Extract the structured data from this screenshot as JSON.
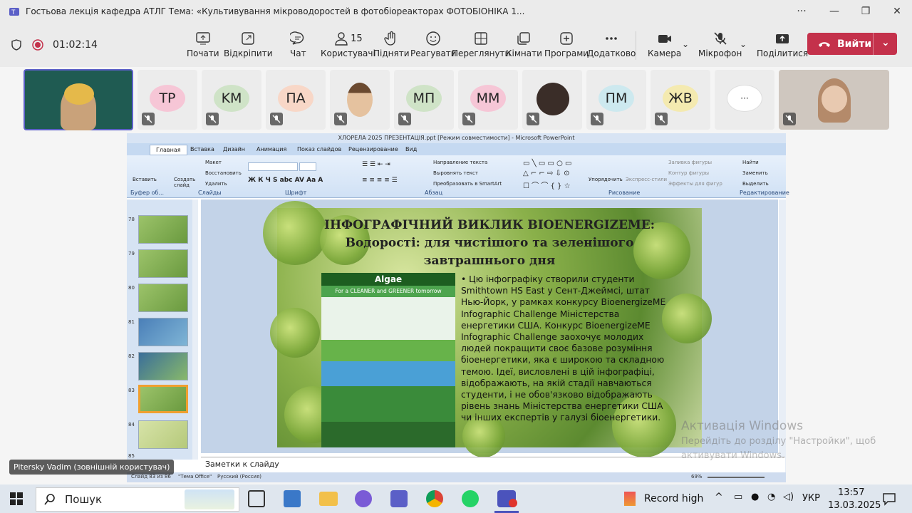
{
  "window": {
    "title": "Гостьова лекція кафедра АТЛГ Тема: «Культивування мікроводоростей в фотобіореакторах ФОТОБІОНІКА 1...",
    "more": "···"
  },
  "meeting": {
    "timer": "01:02:14",
    "toolbar": [
      {
        "label": "Почати",
        "icon": "start-icon"
      },
      {
        "label": "Відкріпити",
        "icon": "unpin-icon"
      },
      {
        "label": "Чат",
        "icon": "chat-icon"
      },
      {
        "label": "Користувачі",
        "icon": "people-icon",
        "count": "15"
      },
      {
        "label": "Підняти",
        "icon": "raise-hand-icon"
      },
      {
        "label": "Реагувати",
        "icon": "react-icon"
      },
      {
        "label": "Переглянути",
        "icon": "view-icon"
      },
      {
        "label": "Кімнати",
        "icon": "rooms-icon"
      },
      {
        "label": "Програми",
        "icon": "apps-icon"
      },
      {
        "label": "Додатково",
        "icon": "more-icon"
      },
      {
        "label": "Камера",
        "icon": "camera-icon"
      },
      {
        "label": "Мікрофон",
        "icon": "mic-off-icon"
      },
      {
        "label": "Поділитися",
        "icon": "share-icon"
      }
    ],
    "leave_label": "Вийти",
    "participants": [
      {
        "initials": "TP",
        "color": "#f6c6d6"
      },
      {
        "initials": "KM",
        "color": "#cfe3c7"
      },
      {
        "initials": "ПА",
        "color": "#f8d7c7"
      },
      {
        "initials": "МП",
        "color": "#cfe3c7"
      },
      {
        "initials": "ММ",
        "color": "#f6c6d6"
      },
      {
        "initials": "ПМ",
        "color": "#cde9ef"
      },
      {
        "initials": "ЖВ",
        "color": "#f4eab0"
      },
      {
        "initials": "···",
        "color": "#ffffff"
      }
    ],
    "presenter_name": "Pitersky Vadim (зовнішній користувач)"
  },
  "ppt": {
    "window_title": "ХЛОРЕЛА 2025 ПРЕЗЕНТАЦІЯ.ppt [Режим совместимости] - Microsoft PowerPoint",
    "tabs": [
      "Главная",
      "Вставка",
      "Дизайн",
      "Анимация",
      "Показ слайдов",
      "Рецензирование",
      "Вид"
    ],
    "groups": [
      "Буфер об...",
      "Слайды",
      "Шрифт",
      "Абзац",
      "Рисование",
      "Редактирование"
    ],
    "items": {
      "paste": "Вставить",
      "new_slide": "Создать слайд",
      "layout": "Макет",
      "reset": "Восстановить",
      "delete": "Удалить",
      "text_dir": "Направление текста",
      "align_text": "Выровнять текст",
      "smartart": "Преобразовать в SmartArt",
      "arrange": "Упорядочить",
      "quick_styles": "Экспресс-стили",
      "fill": "Заливка фигуры",
      "outline": "Контур фигуры",
      "effects": "Эффекты для фигур",
      "find": "Найти",
      "replace": "Заменить",
      "select": "Выделить"
    },
    "slide_numbers": [
      "78",
      "79",
      "80",
      "81",
      "82",
      "83",
      "84",
      "85"
    ],
    "slide": {
      "title": "ІНФОГРАФІЧНИЙ ВИКЛИК BIOENERGIZEME: Водорості: для чистішого та зеленішого завтрашнього дня",
      "body": "Цю інфографіку створили студенти Smithtown HS East у Сент-Джеймсі, штат Нью-Йорк, у рамках конкурсу BioenergizeME Infographic Challenge Міністерства енергетики США. Конкурс BioenergizeME Infographic Challenge заохочує молодих людей покращити своє базове розуміння біоенергетики, яка є широкою та складною темою. Ідеї, висловлені в цій інфографіці, відображають, на якій стадії навчаються студенти, і не обов'язково відображають рівень знань Міністерства енергетики США чи інших експертів у галузі біоенергетики.",
      "info_title": "Algae",
      "info_sub": "For a CLEANER and GREENER tomorrow"
    },
    "notes_placeholder": "Заметки к слайду",
    "status": {
      "slide": "Слайд 83 из 86",
      "theme": "\"Тема Office\"",
      "lang": "Русский (Россия)",
      "zoom": "69%"
    }
  },
  "activation": {
    "line1": "Активація Windows",
    "line2": "Перейдіть до розділу \"Настройки\", щоб",
    "line3": "активувати Windows."
  },
  "taskbar": {
    "search": "Пошук",
    "weather": "Record high",
    "lang": "УКР",
    "time": "13:57",
    "date": "13.03.2025"
  }
}
